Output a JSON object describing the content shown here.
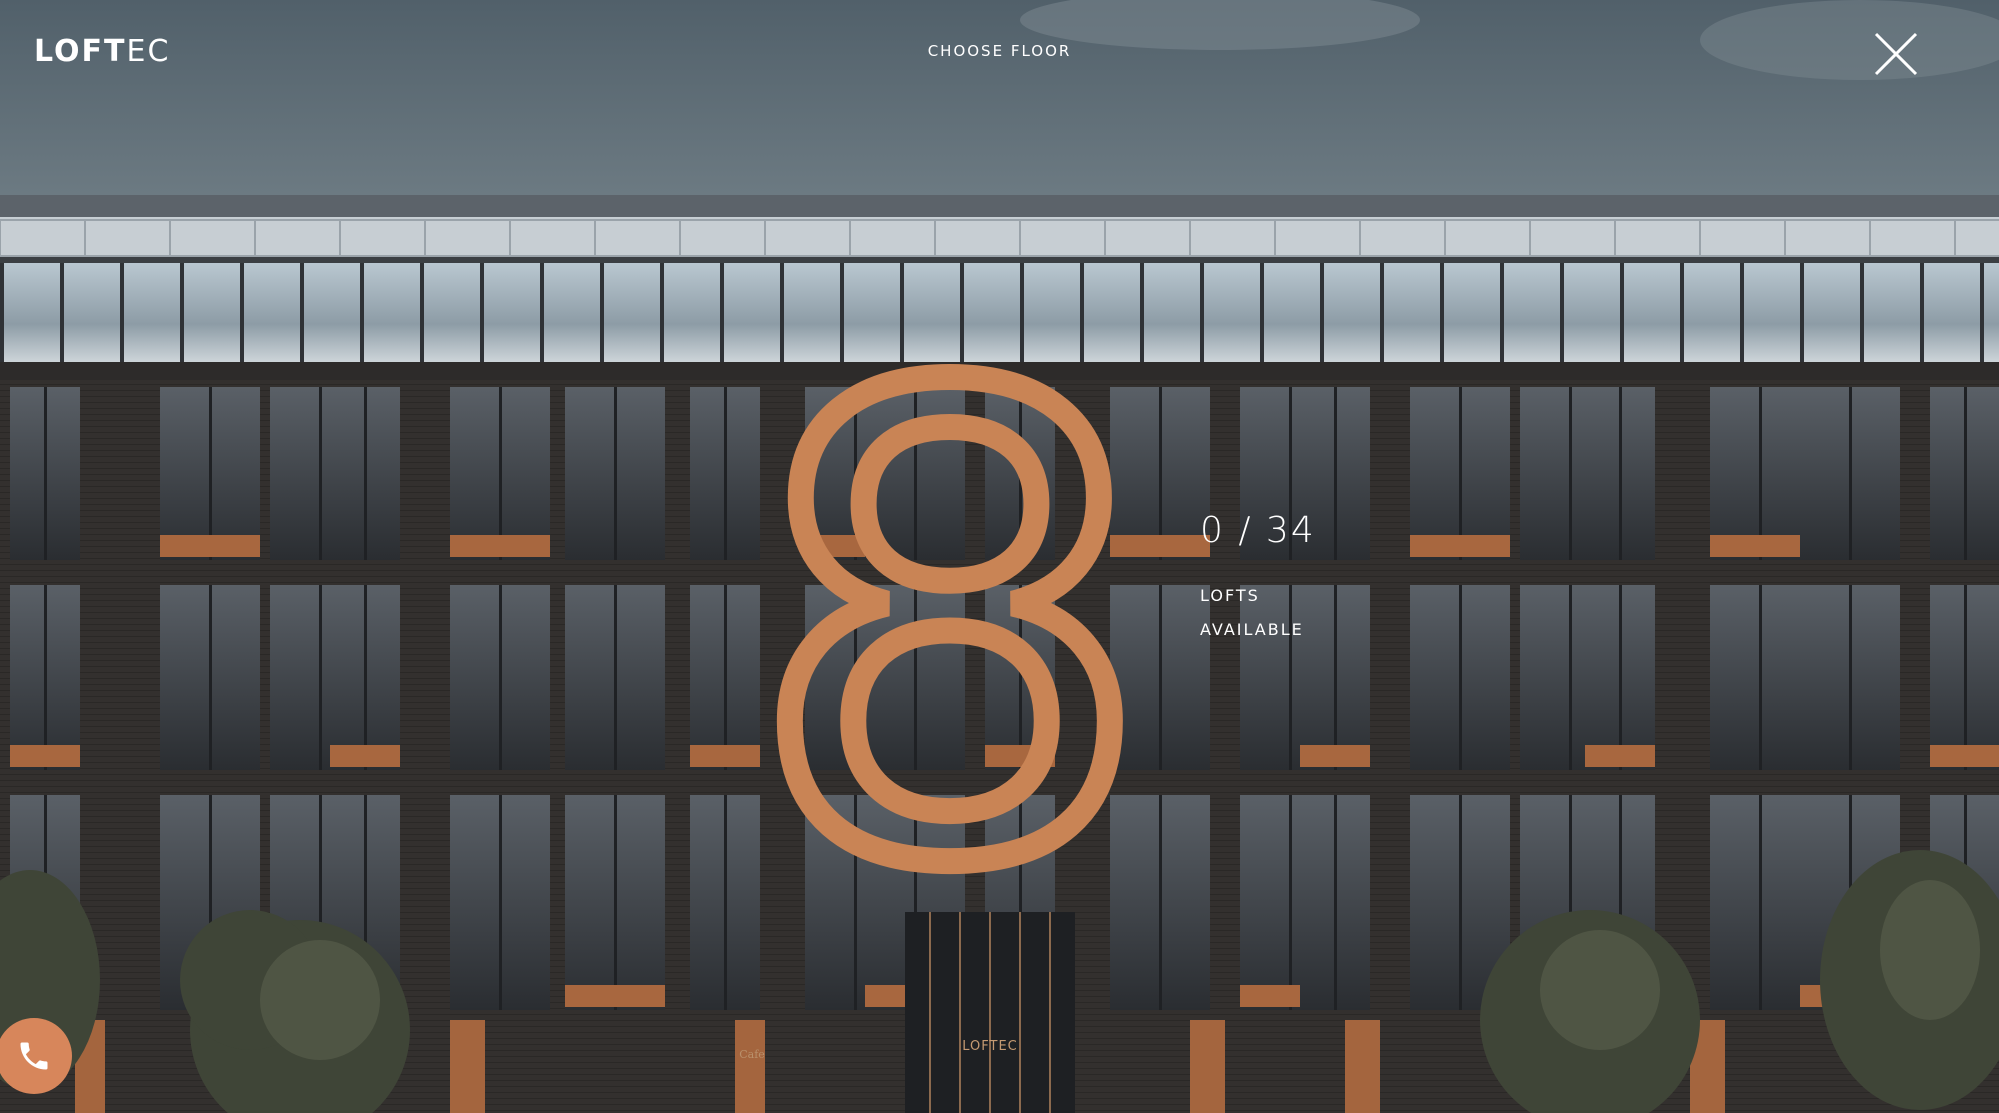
{
  "header": {
    "logo_bold": "LOFT",
    "logo_light": "EC",
    "menu_title": "CHOOSE FLOOR",
    "close_icon": "close-icon"
  },
  "floor": {
    "number": "8",
    "available_count": "0 / 34",
    "available_label_1": "LOFTS",
    "available_label_2": "AVAILABLE"
  },
  "building": {
    "entrance_sign": "LOFTEC",
    "cafe_sign": "Cafe"
  },
  "contact": {
    "phone_icon": "phone-icon"
  },
  "colors": {
    "accent": "#d7865b",
    "copper": "#c98455",
    "text": "#ffffff",
    "sky": "#5f6d75",
    "brick": "#2e2c2b"
  }
}
